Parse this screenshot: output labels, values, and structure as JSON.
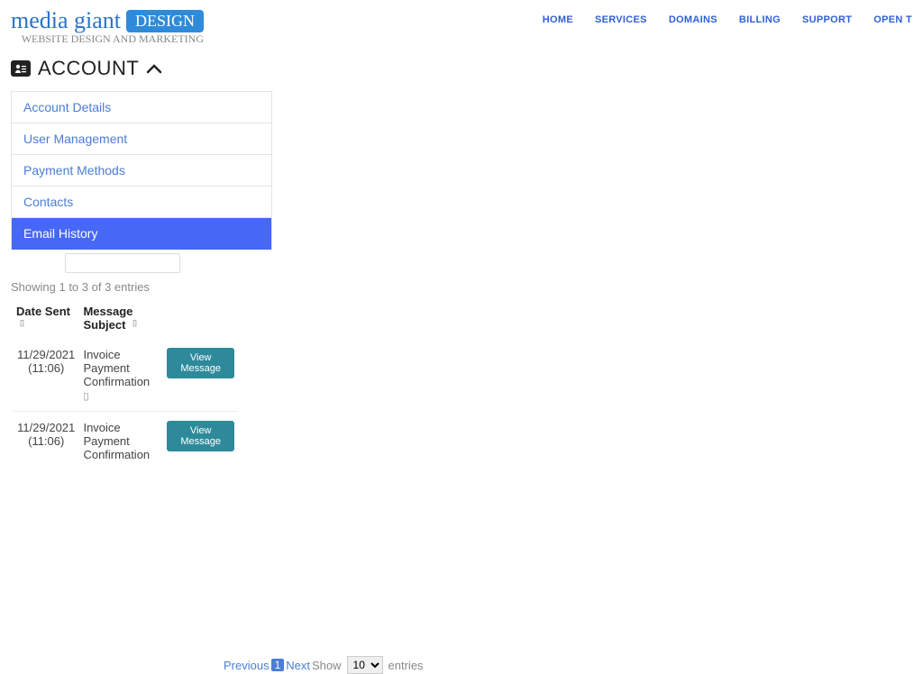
{
  "brand": {
    "name": "media giant",
    "badge": "DESIGN",
    "tagline": "WEBSITE DESIGN AND MARKETING"
  },
  "nav": {
    "home": "HOME",
    "services": "SERVICES",
    "domains": "DOMAINS",
    "billing": "BILLING",
    "support": "SUPPORT",
    "open": "OPEN T"
  },
  "page": {
    "title": "ACCOUNT"
  },
  "tabs": {
    "account_details": "Account Details",
    "user_management": "User Management",
    "payment_methods": "Payment Methods",
    "contacts": "Contacts",
    "email_history": "Email History"
  },
  "table": {
    "info": "Showing 1 to 3 of 3 entries",
    "col_date": "Date Sent",
    "col_subject": "Message Subject",
    "view_label": "View Message",
    "rows": [
      {
        "date": "11/29/2021 (11:06)",
        "subject": "Invoice Payment Confirmation"
      },
      {
        "date": "11/29/2021 (11:06)",
        "subject": "Invoice Payment Confirmation"
      }
    ]
  },
  "pagination": {
    "previous": "Previous",
    "current": "1",
    "next": "Next",
    "show": "Show",
    "perpage": "10",
    "entries": "entries"
  }
}
